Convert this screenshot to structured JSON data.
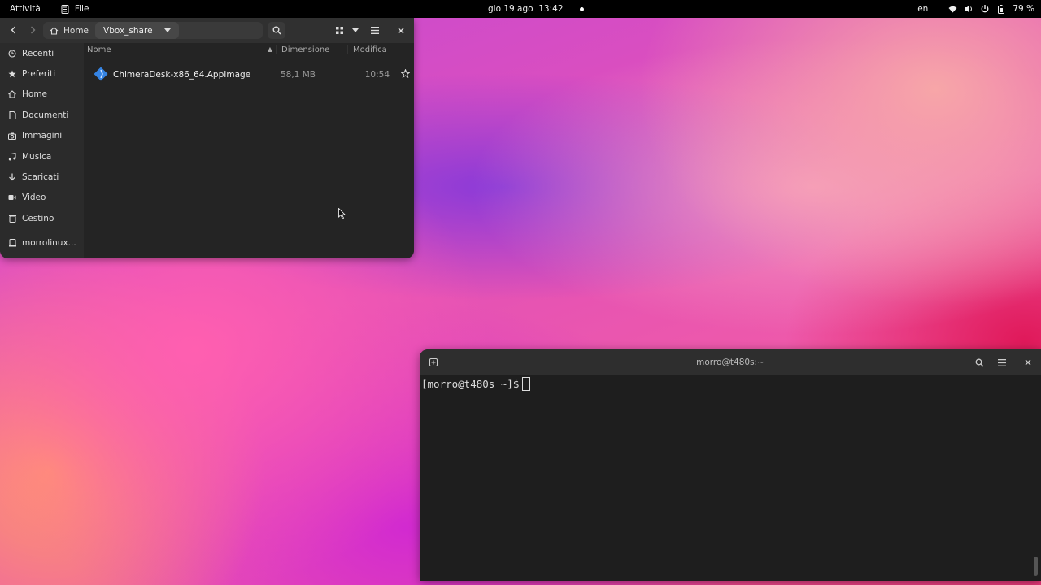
{
  "topbar": {
    "activities": "Attività",
    "app_name": "File",
    "datetime": "gio 19 ago  13:42",
    "language": "en",
    "battery": "79 %"
  },
  "file_manager": {
    "path": {
      "home": "Home",
      "current": "Vbox_share"
    },
    "sidebar": {
      "items": [
        {
          "label": "Recenti",
          "icon": "clock-icon"
        },
        {
          "label": "Preferiti",
          "icon": "star-icon"
        },
        {
          "label": "Home",
          "icon": "home-icon"
        },
        {
          "label": "Documenti",
          "icon": "document-icon"
        },
        {
          "label": "Immagini",
          "icon": "camera-icon"
        },
        {
          "label": "Musica",
          "icon": "music-icon"
        },
        {
          "label": "Scaricati",
          "icon": "download-icon"
        },
        {
          "label": "Video",
          "icon": "video-icon"
        },
        {
          "label": "Cestino",
          "icon": "trash-icon"
        }
      ],
      "device": {
        "label": "morrolinux...",
        "icon": "drive-icon"
      }
    },
    "columns": {
      "name": "Nome",
      "size": "Dimensione",
      "modified": "Modifica"
    },
    "files": [
      {
        "name": "ChimeraDesk-x86_64.AppImage",
        "size": "58,1 MB",
        "modified": "10:54"
      }
    ]
  },
  "terminal": {
    "title": "morro@t480s:~",
    "prompt": "[morro@t480s ~]$"
  },
  "colors": {
    "topbar": "#000000",
    "window_bg": "#242424",
    "header_bg": "#303030",
    "accent_file_icon": "#3584e4"
  }
}
